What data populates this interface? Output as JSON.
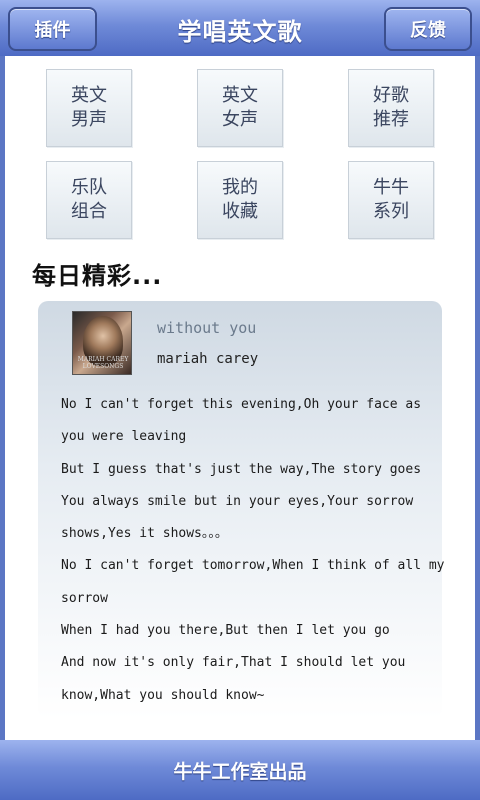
{
  "header": {
    "title": "学唱英文歌",
    "left_button": "插件",
    "right_button": "反馈"
  },
  "categories": [
    {
      "line1": "英文",
      "line2": "男声"
    },
    {
      "line1": "英文",
      "line2": "女声"
    },
    {
      "line1": "好歌",
      "line2": "推荐"
    },
    {
      "line1": "乐队",
      "line2": "组合"
    },
    {
      "line1": "我的",
      "line2": "收藏"
    },
    {
      "line1": "牛牛",
      "line2": "系列"
    }
  ],
  "daily": {
    "section_title": "每日精彩...",
    "album_cover_text": "MARIAH CAREY LOVESONGS",
    "song_title": "without you",
    "artist": "mariah carey",
    "lyrics": [
      "No I can't forget this evening,Oh your face as",
      "you were leaving",
      "But I guess that's just the way,The story goes",
      "You always smile but in your eyes,Your sorrow",
      "shows,Yes it shows。。。",
      "No I can't forget tomorrow,When I think of all my",
      "sorrow",
      "When I had you there,But then I let you go",
      "And now it's only fair,That I should let you",
      "know,What you should know~"
    ]
  },
  "footer": {
    "text": "牛牛工作室出品"
  }
}
